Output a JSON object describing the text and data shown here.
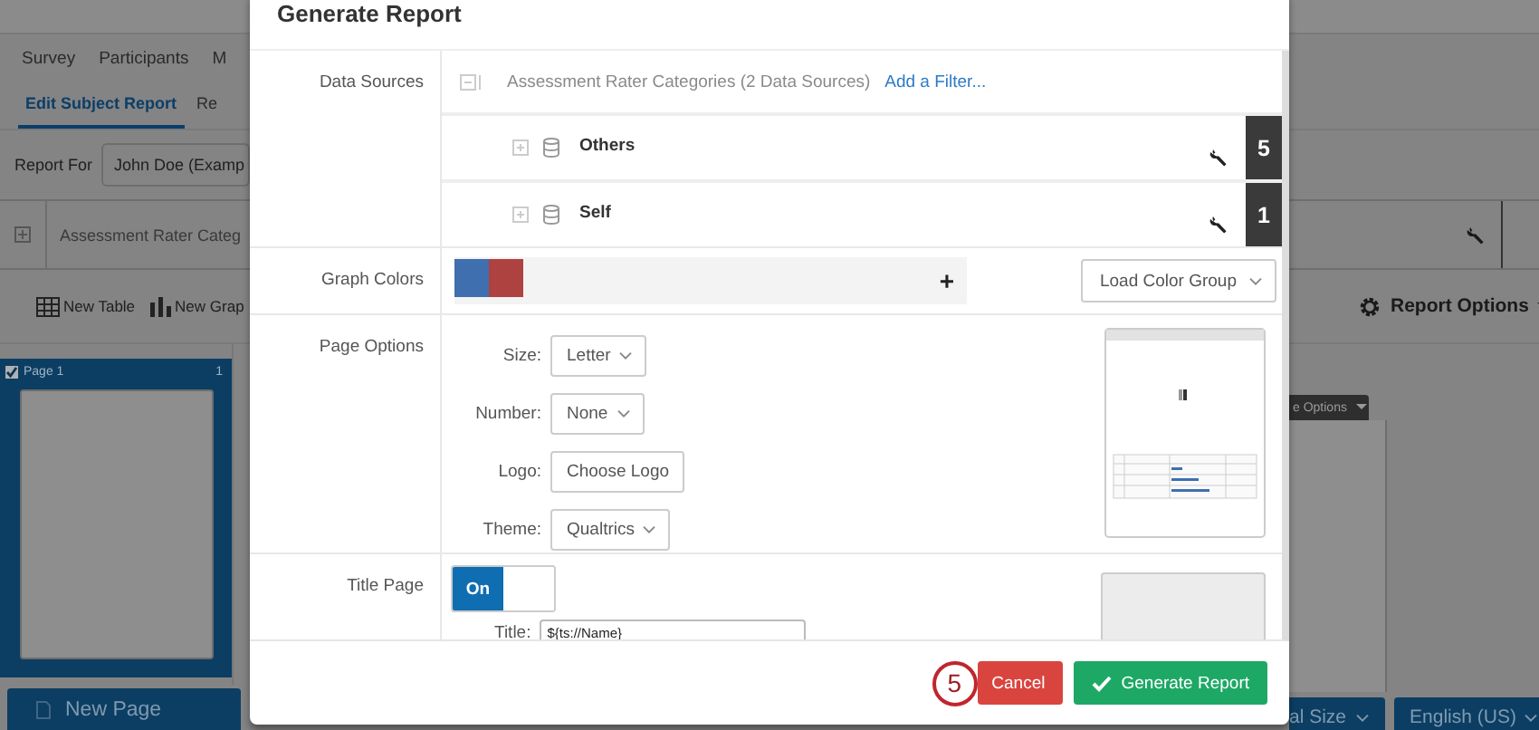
{
  "background": {
    "nav_tabs": [
      "Survey",
      "Participants",
      "M"
    ],
    "sub_tabs": [
      {
        "label": "Edit Subject Report",
        "selected": true
      },
      {
        "label": "Re",
        "selected": false
      }
    ],
    "report_for": {
      "label": "Report For",
      "value": "John Doe (Examp"
    },
    "data_source_bar": "Assessment Rater Categ",
    "toolbar": [
      "New Table",
      "New Grap"
    ],
    "report_options": "Report Options",
    "pages": [
      {
        "label": "Page 1",
        "number": "1",
        "checked": true,
        "selected": true
      }
    ],
    "page_menu": "e Options",
    "new_page": "New Page",
    "bottom_buttons": [
      "al Size",
      "English (US)"
    ]
  },
  "dialog": {
    "title": "Generate Report",
    "data_sources": {
      "label": "Data Sources",
      "group": "Assessment Rater Categories (2 Data Sources)",
      "filter_link": "Add a Filter...",
      "sources": [
        {
          "name": "Others",
          "count": "5"
        },
        {
          "name": "Self",
          "count": "1"
        }
      ]
    },
    "graph_colors": {
      "label": "Graph Colors",
      "colors": [
        {
          "color": "#3f6fae"
        },
        {
          "color": "#ad4240"
        }
      ],
      "add": "+",
      "load_button": "Load Color Group"
    },
    "page_options": {
      "label": "Page Options",
      "fields": [
        {
          "label": "Size:",
          "value": "Letter",
          "kind": "select"
        },
        {
          "label": "Number:",
          "value": "None",
          "kind": "select"
        },
        {
          "label": "Logo:",
          "value": "Choose Logo",
          "kind": "button"
        },
        {
          "label": "Theme:",
          "value": "Qualtrics",
          "kind": "select"
        }
      ]
    },
    "title_page": {
      "label": "Title Page",
      "toggle": {
        "label": "On",
        "on": true
      },
      "title_field": {
        "label": "Title:",
        "value": "${ts://Name}"
      }
    },
    "buttons": [
      {
        "label": "Cancel",
        "kind": "cancel"
      },
      {
        "label": "Generate Report",
        "kind": "primary"
      }
    ],
    "step_marker": "5"
  }
}
